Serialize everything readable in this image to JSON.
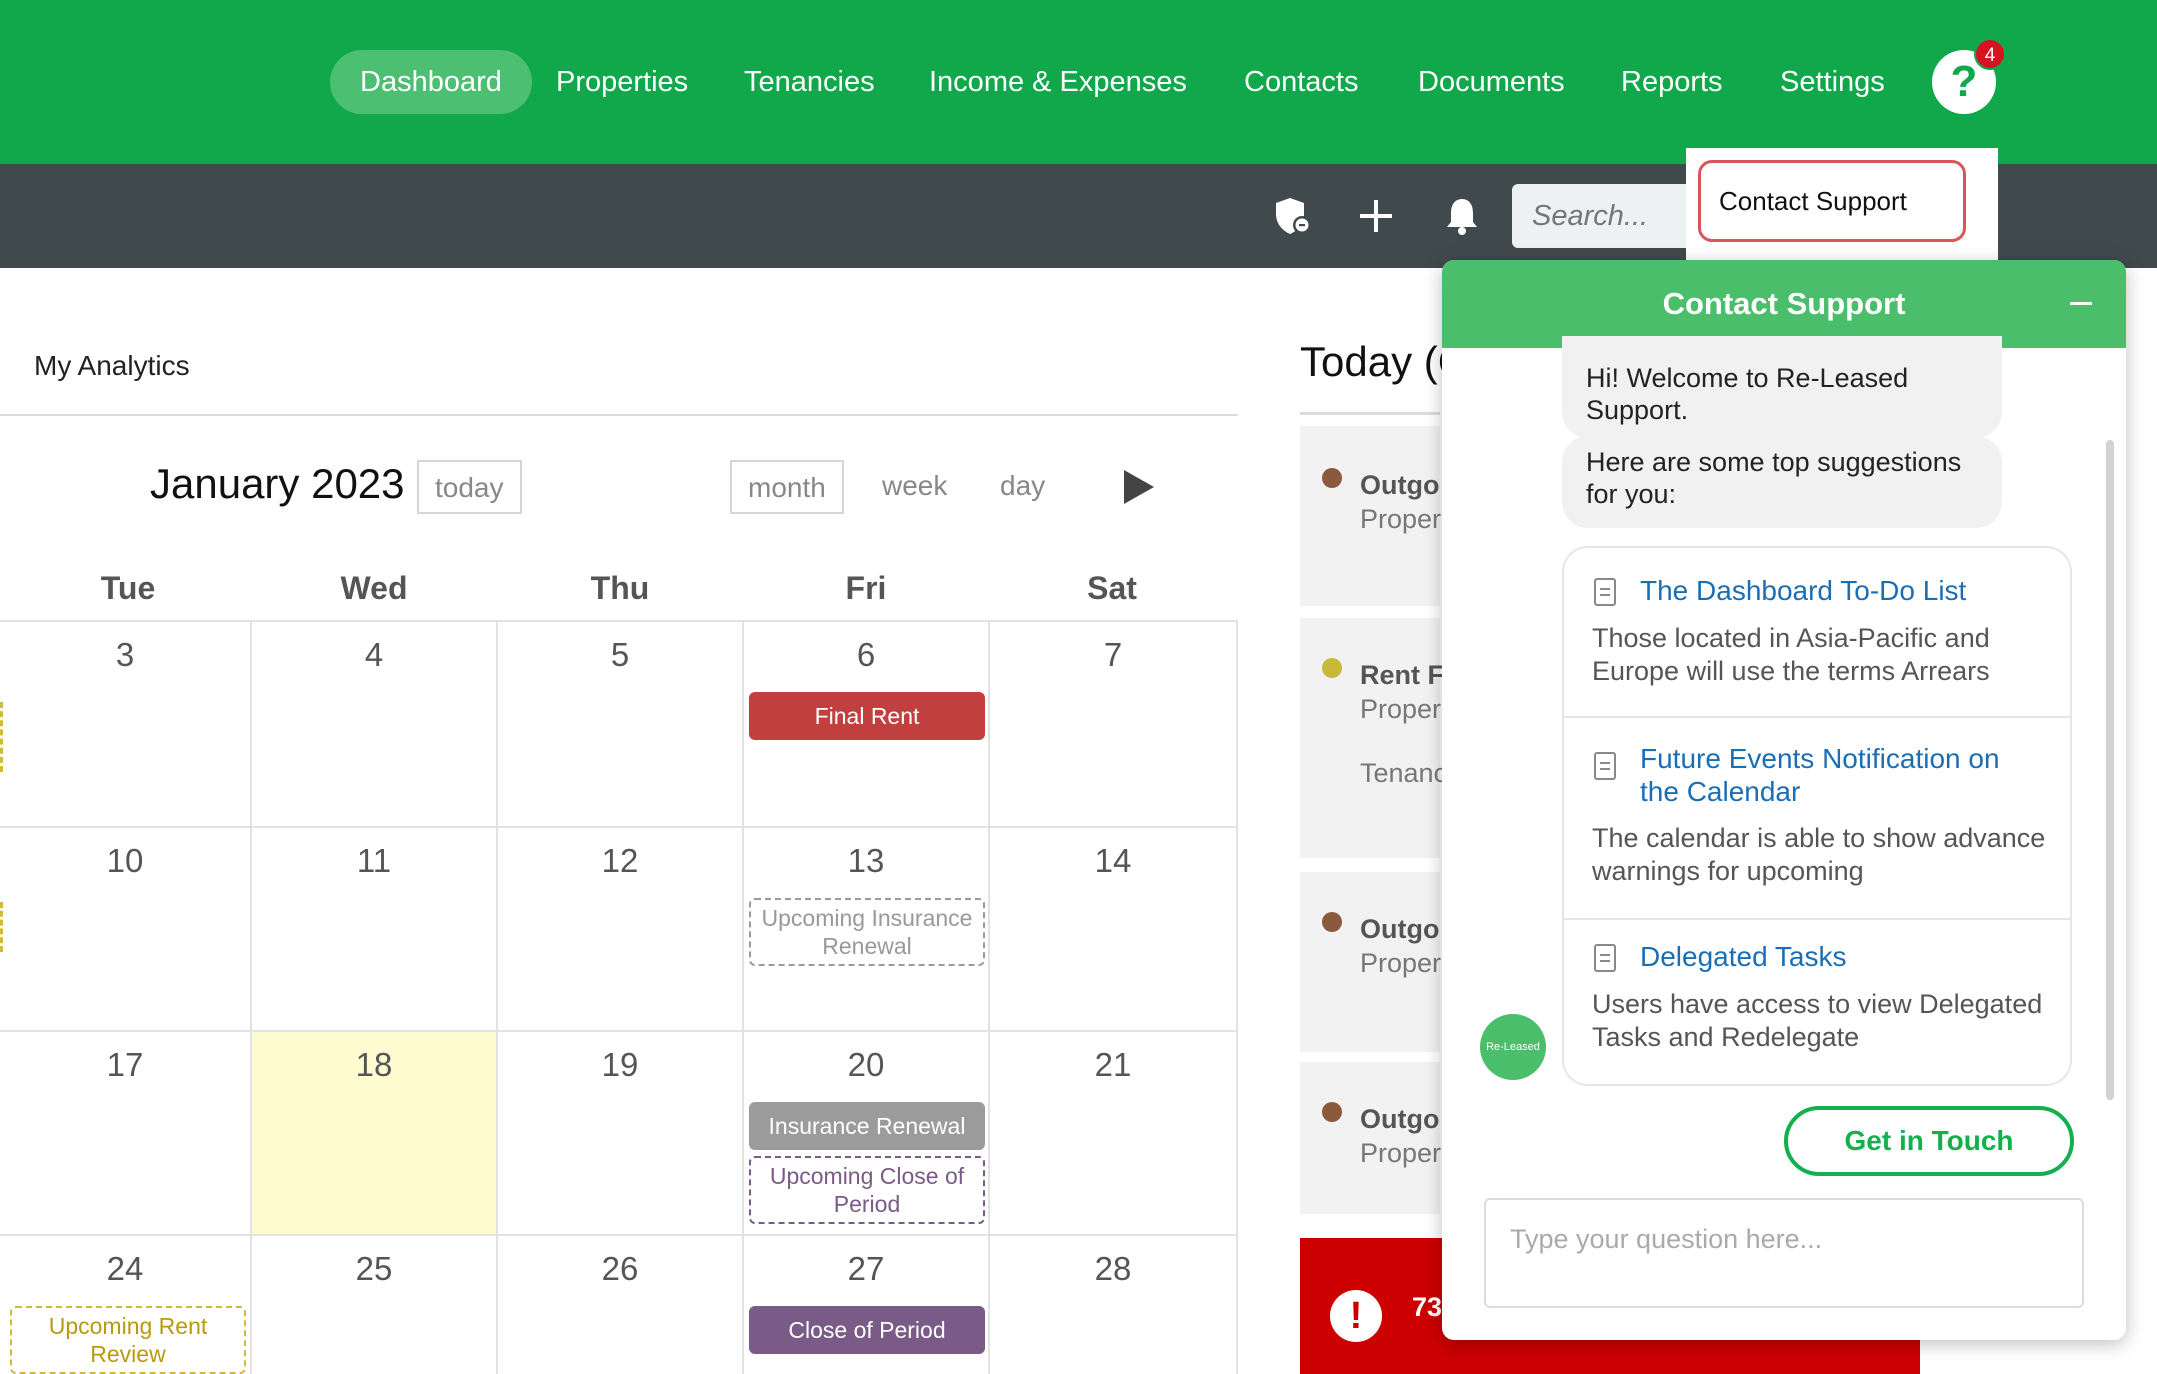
{
  "nav": {
    "items": [
      "Dashboard",
      "Properties",
      "Tenancies",
      "Income & Expenses",
      "Contacts",
      "Documents",
      "Reports",
      "Settings"
    ],
    "active": "Dashboard",
    "help_badge": "4",
    "help_icon": "question-icon"
  },
  "toolbar": {
    "icons": [
      "shield-icon",
      "plus-icon",
      "bell-icon"
    ],
    "search_placeholder": "Search..."
  },
  "help_menu": {
    "item": "Contact Support"
  },
  "panel": {
    "title": "My Analytics"
  },
  "calendar": {
    "title": "January 2023",
    "today_btn": "today",
    "views": [
      "month",
      "week",
      "day"
    ],
    "active_view": "month",
    "weekdays": [
      "Tue",
      "Wed",
      "Thu",
      "Fri",
      "Sat"
    ],
    "weeks": [
      [
        "3",
        "4",
        "5",
        "6",
        "7"
      ],
      [
        "10",
        "11",
        "12",
        "13",
        "14"
      ],
      [
        "17",
        "18",
        "19",
        "20",
        "21"
      ],
      [
        "24",
        "25",
        "26",
        "27",
        "28"
      ]
    ],
    "highlight_day": "18",
    "events": {
      "final_rent": "Final Rent",
      "upcoming_insurance": "Upcoming Insurance Renewal",
      "insurance_renewal": "Insurance Renewal",
      "upcoming_close": "Upcoming Close of Period",
      "upcoming_rent_review": "Upcoming Rent Review",
      "close_of_period": "Close of Period"
    }
  },
  "today_panel": {
    "title": "Today (C",
    "tasks": [
      {
        "title": "Outgo",
        "sub": "Proper",
        "dot": "#8b5a3c"
      },
      {
        "title": "Rent F",
        "sub": "Proper",
        "extra": "Tenanc",
        "dot": "#c9b93a"
      },
      {
        "title": "Outgo",
        "sub": "Proper",
        "dot": "#8b5a3c"
      },
      {
        "title": "Outgo",
        "sub": "Proper",
        "dot": "#8b5a3c"
      }
    ],
    "alert_text": "73"
  },
  "chat": {
    "title": "Contact Support",
    "welcome": "Hi! Welcome to Re-Leased Support.",
    "intro": "Here are some top suggestions for you:",
    "suggestions": [
      {
        "title": "The Dashboard To-Do List",
        "desc": "Those located in Asia-Pacific and Europe will use the terms Arrears"
      },
      {
        "title": "Future Events Notification on the Calendar",
        "desc": "The calendar is able to show advance warnings for upcoming"
      },
      {
        "title": "Delegated Tasks",
        "desc": "Users have access to view Delegated Tasks and Redelegate"
      }
    ],
    "avatar_label": "Re-Leased",
    "cta": "Get in Touch",
    "input_placeholder": "Type your question here..."
  },
  "colors": {
    "brand_green": "#10a84a",
    "toolbar": "#40494c",
    "chat_header": "#4bbe6b",
    "alert_red": "#cc0000",
    "link_blue": "#1a6eb6"
  }
}
